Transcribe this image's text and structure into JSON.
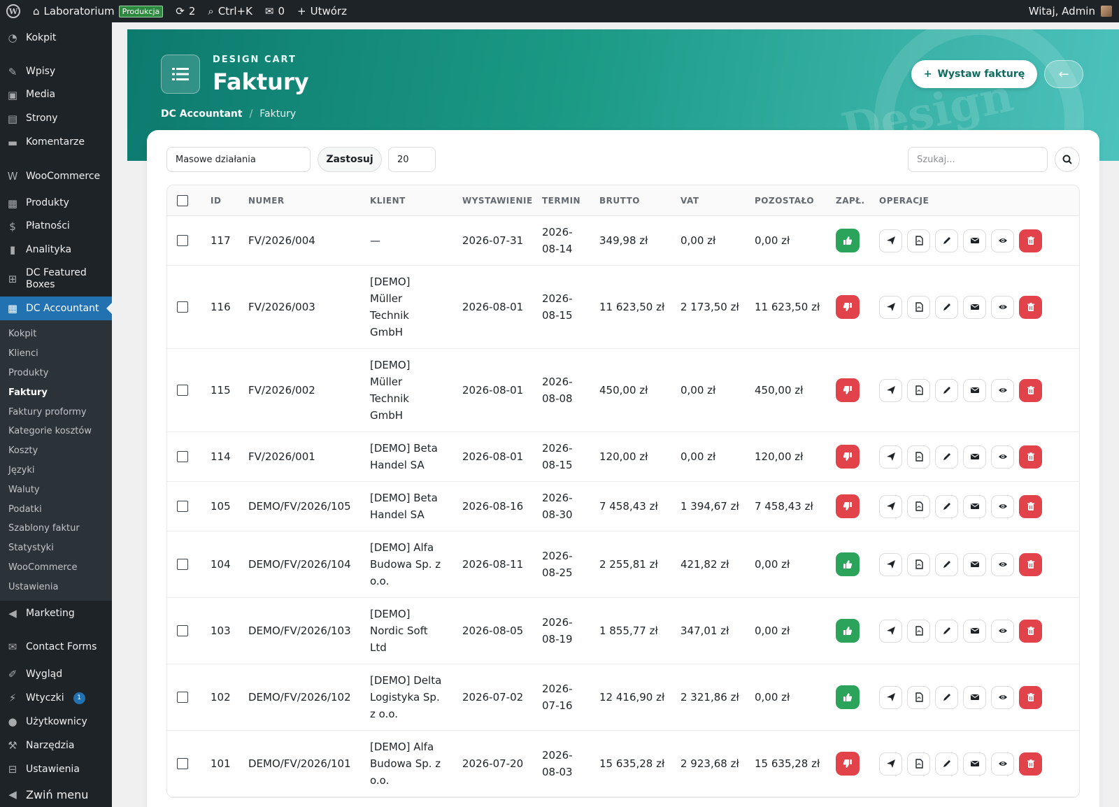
{
  "adminbar": {
    "site_name": "Laboratorium",
    "env_badge": "Produkcja",
    "updates_count": "2",
    "shortcut": "Ctrl+K",
    "comments_count": "0",
    "new_label": "Utwórz",
    "greeting": "Witaj, Admin"
  },
  "sidebar": {
    "items_top": [
      {
        "label": "Kokpit",
        "icon": "dashboard-icon"
      },
      {
        "label": "Wpisy",
        "icon": "pin-icon"
      },
      {
        "label": "Media",
        "icon": "media-icon"
      },
      {
        "label": "Strony",
        "icon": "pages-icon"
      },
      {
        "label": "Komentarze",
        "icon": "comment-icon"
      },
      {
        "label": "WooCommerce",
        "icon": "woo-icon"
      },
      {
        "label": "Produkty",
        "icon": "archive-icon"
      },
      {
        "label": "Płatności",
        "icon": "payments-icon"
      },
      {
        "label": "Analityka",
        "icon": "chart-icon"
      },
      {
        "label": "DC Featured Boxes",
        "icon": "grid-icon"
      },
      {
        "label": "DC Accountant",
        "icon": "calculator-icon"
      }
    ],
    "submenu": [
      "Kokpit",
      "Klienci",
      "Produkty",
      "Faktury",
      "Faktury proformy",
      "Kategorie kosztów",
      "Koszty",
      "Języki",
      "Waluty",
      "Podatki",
      "Szablony faktur",
      "Statystyki",
      "WooCommerce",
      "Ustawienia"
    ],
    "items_bottom": [
      {
        "label": "Marketing",
        "icon": "megaphone-icon"
      },
      {
        "label": "Contact Forms",
        "icon": "mail-icon"
      },
      {
        "label": "Wygląd",
        "icon": "brush-icon"
      },
      {
        "label": "Wtyczki",
        "icon": "plugin-icon",
        "badge": "1"
      },
      {
        "label": "Użytkownicy",
        "icon": "users-icon"
      },
      {
        "label": "Narzędzia",
        "icon": "wrench-icon"
      },
      {
        "label": "Ustawienia",
        "icon": "settings-icon"
      },
      {
        "label": "Zwiń menu",
        "icon": "collapse-icon"
      }
    ]
  },
  "header": {
    "subtitle": "DESIGN CART",
    "title": "Faktury",
    "breadcrumb": [
      "DC Accountant",
      "/",
      "Faktury"
    ],
    "new_button": "Wystaw fakturę",
    "deco_text": "Design"
  },
  "toolbar": {
    "bulk": "Masowe działania",
    "apply": "Zastosuj",
    "per_page": "20",
    "search_placeholder": "Szukaj..."
  },
  "table": {
    "headers": [
      "ID",
      "NUMER",
      "KLIENT",
      "WYSTAWIENIE",
      "TERMIN",
      "BRUTTO",
      "VAT",
      "POZOSTAŁO",
      "ZAPŁ.",
      "OPERACJE"
    ],
    "rows": [
      {
        "id": "117",
        "numer": "FV/2026/004",
        "klient": [
          "—"
        ],
        "wystawienie": "2026-07-31",
        "termin": [
          "2026-",
          "08-14"
        ],
        "brutto": "349,98 zł",
        "vat": "0,00 zł",
        "pozostalo": "0,00 zł",
        "paid": true
      },
      {
        "id": "116",
        "numer": "FV/2026/003",
        "klient": [
          "[DEMO]",
          "Müller",
          "Technik",
          "GmbH"
        ],
        "wystawienie": "2026-08-01",
        "termin": [
          "2026-",
          "08-15"
        ],
        "brutto": "11 623,50 zł",
        "vat": "2 173,50 zł",
        "pozostalo": "11 623,50 zł",
        "paid": false
      },
      {
        "id": "115",
        "numer": "FV/2026/002",
        "klient": [
          "[DEMO]",
          "Müller",
          "Technik",
          "GmbH"
        ],
        "wystawienie": "2026-08-01",
        "termin": [
          "2026-",
          "08-08"
        ],
        "brutto": "450,00 zł",
        "vat": "0,00 zł",
        "pozostalo": "450,00 zł",
        "paid": false
      },
      {
        "id": "114",
        "numer": "FV/2026/001",
        "klient": [
          "[DEMO] Beta",
          "Handel SA"
        ],
        "wystawienie": "2026-08-01",
        "termin": [
          "2026-",
          "08-15"
        ],
        "brutto": "120,00 zł",
        "vat": "0,00 zł",
        "pozostalo": "120,00 zł",
        "paid": false
      },
      {
        "id": "105",
        "numer": "DEMO/FV/2026/105",
        "klient": [
          "[DEMO] Beta",
          "Handel SA"
        ],
        "wystawienie": "2026-08-16",
        "termin": [
          "2026-",
          "08-30"
        ],
        "brutto": "7 458,43 zł",
        "vat": "1 394,67 zł",
        "pozostalo": "7 458,43 zł",
        "paid": false
      },
      {
        "id": "104",
        "numer": "DEMO/FV/2026/104",
        "klient": [
          "[DEMO] Alfa",
          "Budowa Sp. z",
          "o.o."
        ],
        "wystawienie": "2026-08-11",
        "termin": [
          "2026-",
          "08-25"
        ],
        "brutto": "2 255,81 zł",
        "vat": "421,82 zł",
        "pozostalo": "0,00 zł",
        "paid": true
      },
      {
        "id": "103",
        "numer": "DEMO/FV/2026/103",
        "klient": [
          "[DEMO]",
          "Nordic Soft",
          "Ltd"
        ],
        "wystawienie": "2026-08-05",
        "termin": [
          "2026-",
          "08-19"
        ],
        "brutto": "1 855,77 zł",
        "vat": "347,01 zł",
        "pozostalo": "0,00 zł",
        "paid": true
      },
      {
        "id": "102",
        "numer": "DEMO/FV/2026/102",
        "klient": [
          "[DEMO] Delta",
          "Logistyka Sp.",
          "z o.o."
        ],
        "wystawienie": "2026-07-02",
        "termin": [
          "2026-",
          "07-16"
        ],
        "brutto": "12 416,90 zł",
        "vat": "2 321,86 zł",
        "pozostalo": "0,00 zł",
        "paid": true
      },
      {
        "id": "101",
        "numer": "DEMO/FV/2026/101",
        "klient": [
          "[DEMO] Alfa",
          "Budowa Sp. z",
          "o.o."
        ],
        "wystawienie": "2026-07-20",
        "termin": [
          "2026-",
          "08-03"
        ],
        "brutto": "15 635,28 zł",
        "vat": "2 923,68 zł",
        "pozostalo": "15 635,28 zł",
        "paid": false
      }
    ],
    "operations": [
      "send-icon",
      "pdf-icon",
      "edit-icon",
      "email-icon",
      "view-icon",
      "delete-icon"
    ]
  },
  "colors": {
    "paid": "#2ba35b",
    "unpaid": "#e2434b",
    "accent": "#2271b1",
    "header_start": "#0d7a6e",
    "header_end": "#4dc2bd"
  }
}
